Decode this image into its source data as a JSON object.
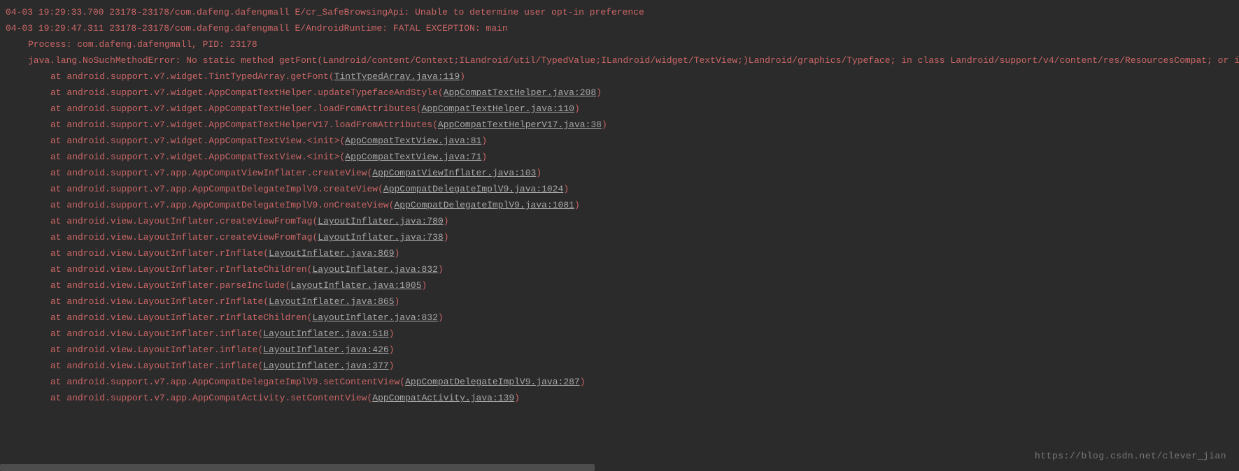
{
  "log": [
    {
      "type": "head",
      "css": "err indent0",
      "text": "04-03 19:29:33.700 23178-23178/com.dafeng.dafengmall E/cr_SafeBrowsingApi: Unable to determine user opt-in preference"
    },
    {
      "type": "head",
      "css": "err indent0",
      "text": "04-03 19:29:47.311 23178-23178/com.dafeng.dafengmall E/AndroidRuntime: FATAL EXCEPTION: main"
    },
    {
      "type": "head",
      "css": "err indent1",
      "text": "Process: com.dafeng.dafengmall, PID: 23178"
    },
    {
      "type": "head",
      "css": "err indent1",
      "text": "java.lang.NoSuchMethodError: No static method getFont(Landroid/content/Context;ILandroid/util/TypedValue;ILandroid/widget/TextView;)Landroid/graphics/Typeface; in class Landroid/support/v4/content/res/ResourcesCompat; or its super classes"
    },
    {
      "type": "frame",
      "at": "at android.support.v7.widget.TintTypedArray.getFont",
      "link": "TintTypedArray.java:119"
    },
    {
      "type": "frame",
      "at": "at android.support.v7.widget.AppCompatTextHelper.updateTypefaceAndStyle",
      "link": "AppCompatTextHelper.java:208"
    },
    {
      "type": "frame",
      "at": "at android.support.v7.widget.AppCompatTextHelper.loadFromAttributes",
      "link": "AppCompatTextHelper.java:110"
    },
    {
      "type": "frame",
      "at": "at android.support.v7.widget.AppCompatTextHelperV17.loadFromAttributes",
      "link": "AppCompatTextHelperV17.java:38"
    },
    {
      "type": "frame",
      "at": "at android.support.v7.widget.AppCompatTextView.<init>",
      "link": "AppCompatTextView.java:81"
    },
    {
      "type": "frame",
      "at": "at android.support.v7.widget.AppCompatTextView.<init>",
      "link": "AppCompatTextView.java:71"
    },
    {
      "type": "frame",
      "at": "at android.support.v7.app.AppCompatViewInflater.createView",
      "link": "AppCompatViewInflater.java:103"
    },
    {
      "type": "frame",
      "at": "at android.support.v7.app.AppCompatDelegateImplV9.createView",
      "link": "AppCompatDelegateImplV9.java:1024"
    },
    {
      "type": "frame",
      "at": "at android.support.v7.app.AppCompatDelegateImplV9.onCreateView",
      "link": "AppCompatDelegateImplV9.java:1081"
    },
    {
      "type": "frame",
      "at": "at android.view.LayoutInflater.createViewFromTag",
      "link": "LayoutInflater.java:780"
    },
    {
      "type": "frame",
      "at": "at android.view.LayoutInflater.createViewFromTag",
      "link": "LayoutInflater.java:738"
    },
    {
      "type": "frame",
      "at": "at android.view.LayoutInflater.rInflate",
      "link": "LayoutInflater.java:869"
    },
    {
      "type": "frame",
      "at": "at android.view.LayoutInflater.rInflateChildren",
      "link": "LayoutInflater.java:832"
    },
    {
      "type": "frame",
      "at": "at android.view.LayoutInflater.parseInclude",
      "link": "LayoutInflater.java:1005"
    },
    {
      "type": "frame",
      "at": "at android.view.LayoutInflater.rInflate",
      "link": "LayoutInflater.java:865"
    },
    {
      "type": "frame",
      "at": "at android.view.LayoutInflater.rInflateChildren",
      "link": "LayoutInflater.java:832"
    },
    {
      "type": "frame",
      "at": "at android.view.LayoutInflater.inflate",
      "link": "LayoutInflater.java:518"
    },
    {
      "type": "frame",
      "at": "at android.view.LayoutInflater.inflate",
      "link": "LayoutInflater.java:426"
    },
    {
      "type": "frame",
      "at": "at android.view.LayoutInflater.inflate",
      "link": "LayoutInflater.java:377"
    },
    {
      "type": "frame",
      "at": "at android.support.v7.app.AppCompatDelegateImplV9.setContentView",
      "link": "AppCompatDelegateImplV9.java:287"
    },
    {
      "type": "frame",
      "at": "at android.support.v7.app.AppCompatActivity.setContentView",
      "link": "AppCompatActivity.java:139"
    }
  ],
  "watermark": "https://blog.csdn.net/clever_jian"
}
